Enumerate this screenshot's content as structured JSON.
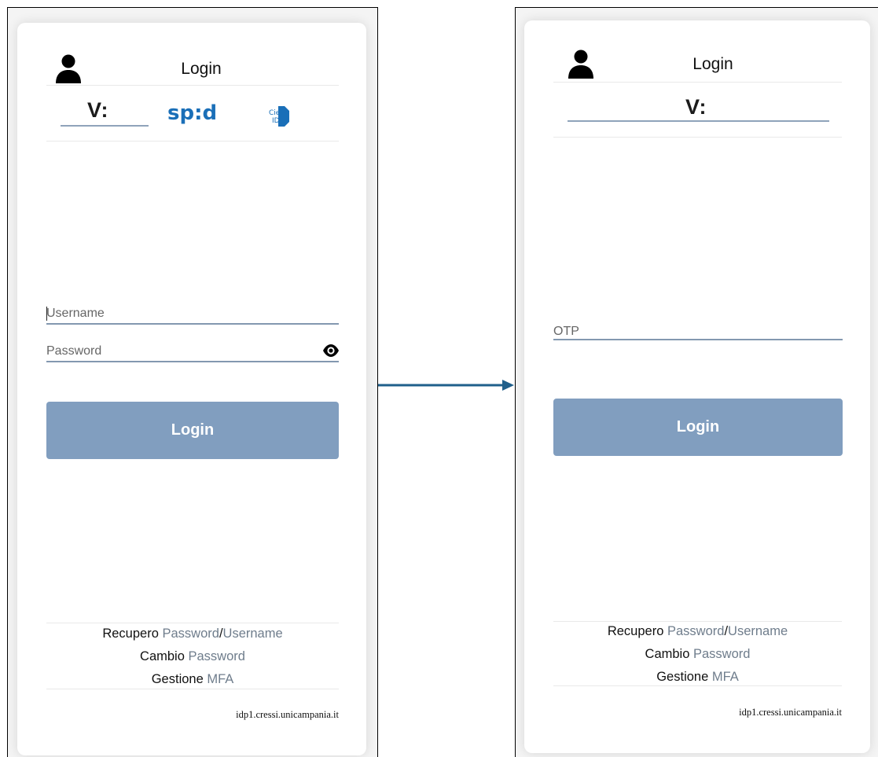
{
  "left_screen": {
    "header": {
      "title": "Login",
      "icon": "user-icon"
    },
    "tabs": [
      {
        "label": "V:",
        "active": true
      },
      {
        "label": "sp:d",
        "active": false
      },
      {
        "label": "Cie ID",
        "active": false
      }
    ],
    "username": {
      "placeholder": "Username",
      "value": ""
    },
    "password": {
      "placeholder": "Password",
      "value": "",
      "toggle_icon": "eye-icon"
    },
    "login_button": "Login",
    "footer": {
      "recovery_prefix": "Recupero",
      "recovery_password": "Password",
      "recovery_sep": "/",
      "recovery_username": "Username",
      "change_prefix": "Cambio",
      "change_password": "Password",
      "manage_prefix": "Gestione",
      "manage_mfa": "MFA"
    },
    "host": "idp1.cressi.unicampania.it"
  },
  "right_screen": {
    "header": {
      "title": "Login",
      "icon": "user-icon"
    },
    "tabs": [
      {
        "label": "V:",
        "active": true
      }
    ],
    "otp": {
      "placeholder": "OTP",
      "value": ""
    },
    "login_button": "Login",
    "footer": {
      "recovery_prefix": "Recupero",
      "recovery_password": "Password",
      "recovery_sep": "/",
      "recovery_username": "Username",
      "change_prefix": "Cambio",
      "change_password": "Password",
      "manage_prefix": "Gestione",
      "manage_mfa": "MFA"
    },
    "host": "idp1.cressi.unicampania.it"
  },
  "colors": {
    "accent": "#819ebf",
    "input_underline": "#8398b0",
    "spid_blue": "#1a6fb8",
    "link_muted": "#6f7d8c",
    "arrow": "#1f5f8b"
  }
}
